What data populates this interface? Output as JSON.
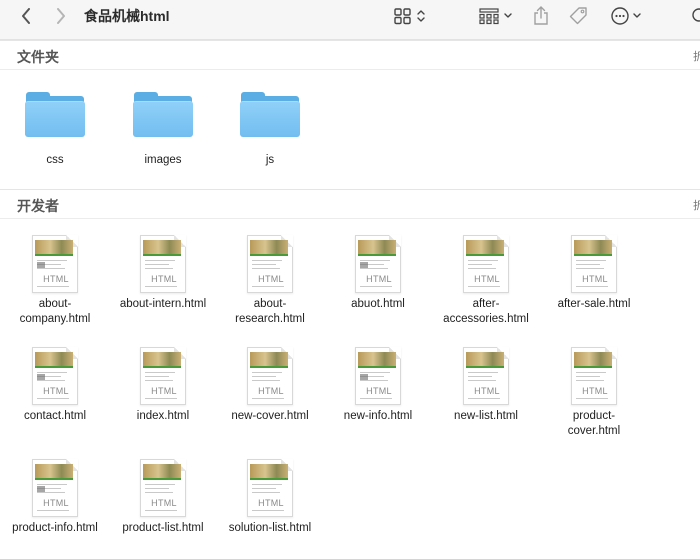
{
  "window": {
    "title": "食品机械html"
  },
  "toolbar": {
    "icons": [
      "chevron-left-icon",
      "chevron-right-icon",
      "grid-view-icon",
      "group-icon",
      "share-icon",
      "tag-icon",
      "more-icon"
    ]
  },
  "sections": [
    {
      "title": "文件夹",
      "fold_label": "折",
      "items": [
        {
          "label": "css"
        },
        {
          "label": "images"
        },
        {
          "label": "js"
        }
      ]
    },
    {
      "title": "开发者",
      "fold_label": "折",
      "badge": "HTML",
      "items": [
        {
          "label": "about-\ncompany.html"
        },
        {
          "label": "about-intern.html"
        },
        {
          "label": "about-\nresearch.html"
        },
        {
          "label": "abuot.html"
        },
        {
          "label": "after-\naccessories.html"
        },
        {
          "label": "after-sale.html"
        },
        {
          "label": "contact.html"
        },
        {
          "label": "index.html"
        },
        {
          "label": "new-cover.html"
        },
        {
          "label": "new-info.html"
        },
        {
          "label": "new-list.html"
        },
        {
          "label": "product-\ncover.html"
        },
        {
          "label": "product-info.html"
        },
        {
          "label": "product-list.html"
        },
        {
          "label": "solution-list.html"
        }
      ]
    }
  ],
  "colors": {
    "folder": "#72bdf0",
    "toolbar_bg": "#f6f6f6",
    "accent_green": "#4a9a3a"
  }
}
